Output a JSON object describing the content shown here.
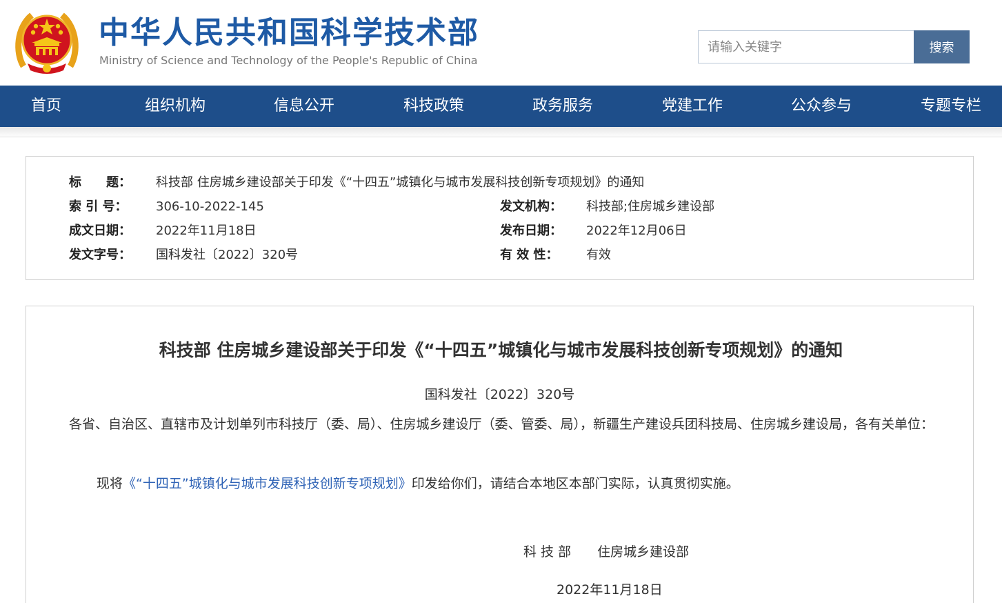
{
  "header": {
    "title": "中华人民共和国科学技术部",
    "subtitle": "Ministry of Science and Technology of the People's Republic of China",
    "emblem_icon": "national-emblem-icon",
    "title_color": "#1e5aa5"
  },
  "search": {
    "placeholder": "请输入关键字",
    "value": "",
    "button_label": "搜索",
    "button_color": "#4a6d96"
  },
  "nav": {
    "background": "#1e4e8a",
    "items": [
      {
        "label": "首页"
      },
      {
        "label": "组织机构"
      },
      {
        "label": "信息公开"
      },
      {
        "label": "科技政策"
      },
      {
        "label": "政务服务"
      },
      {
        "label": "党建工作"
      },
      {
        "label": "公众参与"
      },
      {
        "label": "专题专栏"
      }
    ]
  },
  "meta": {
    "title_label": "标　　题：",
    "title_value": "科技部 住房城乡建设部关于印发《“十四五”城镇化与城市发展科技创新专项规划》的通知",
    "index_label": "索 引 号：",
    "index_value": "306-10-2022-145",
    "issuer_label": "发文机构：",
    "issuer_value": "科技部;住房城乡建设部",
    "date_written_label": "成文日期：",
    "date_written_value": "2022年11月18日",
    "date_published_label": "发布日期：",
    "date_published_value": "2022年12月06日",
    "doc_number_label": "发文字号：",
    "doc_number_value": "国科发社〔2022〕320号",
    "validity_label": "有 效 性：",
    "validity_value": "有效"
  },
  "content": {
    "title": "科技部 住房城乡建设部关于印发《“十四五”城镇化与城市发展科技创新专项规划》的通知",
    "doc_number": "国科发社〔2022〕320号",
    "recipients": "各省、自治区、直辖市及计划单列市科技厅（委、局）、住房城乡建设厅（委、管委、局），新疆生产建设兵团科技局、住房城乡建设局，各有关单位：",
    "body_prefix": "现将",
    "body_link": "《“十四五”城镇化与城市发展科技创新专项规划》",
    "body_suffix": "印发给你们，请结合本地区本部门实际，认真贯彻实施。",
    "link_color": "#2f63b6",
    "signer_1": "科 技 部",
    "signer_2": "住房城乡建设部",
    "date": "2022年11月18日"
  }
}
